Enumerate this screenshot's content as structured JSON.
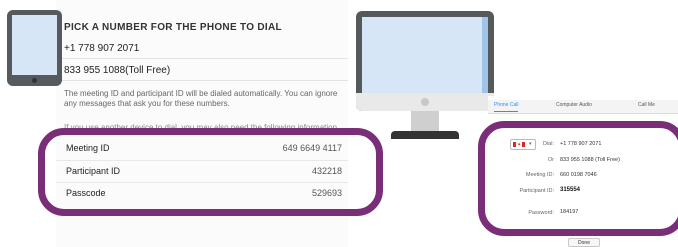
{
  "dial": {
    "heading": "PICK A NUMBER FOR THE PHONE TO DIAL",
    "numbers": [
      "+1 778 907 2071",
      "833 955 1088(Toll Free)"
    ],
    "note": "The meeting ID and participant ID will be dialed automatically. You can ignore any messages that ask you for these numbers.",
    "faded_note": "If you use another device to dial, you may also need the following information."
  },
  "meeting": {
    "rows": [
      {
        "label": "Meeting ID",
        "value": "649 6649 4117"
      },
      {
        "label": "Participant ID",
        "value": "432218"
      },
      {
        "label": "Passcode",
        "value": "529693"
      }
    ]
  },
  "zoom": {
    "tabs": [
      "Phone Call",
      "Computer Audio",
      "Call Me"
    ],
    "active_tab": "Phone Call",
    "dial_label": "Dial:",
    "dial_number": "+1 778 907 2071",
    "or_label": "Or",
    "or_number": "833 955 1088 (Toll Free)",
    "meeting_id_label": "Meeting ID:",
    "meeting_id": "660 0198 7046",
    "participant_id_label": "Participant ID:",
    "participant_id": "315554",
    "password_label": "Password:",
    "password": "184197",
    "done_label": "Done"
  },
  "colors": {
    "highlight": "#7b2e78",
    "device_frame": "#56595c",
    "device_screen": "#d6e6f7",
    "zoom_accent": "#2d8cff",
    "flag_red": "#d52b1e"
  },
  "icons": [
    "tablet-icon",
    "monitor-icon",
    "canada-flag-icon",
    "chevron-down-icon"
  ]
}
